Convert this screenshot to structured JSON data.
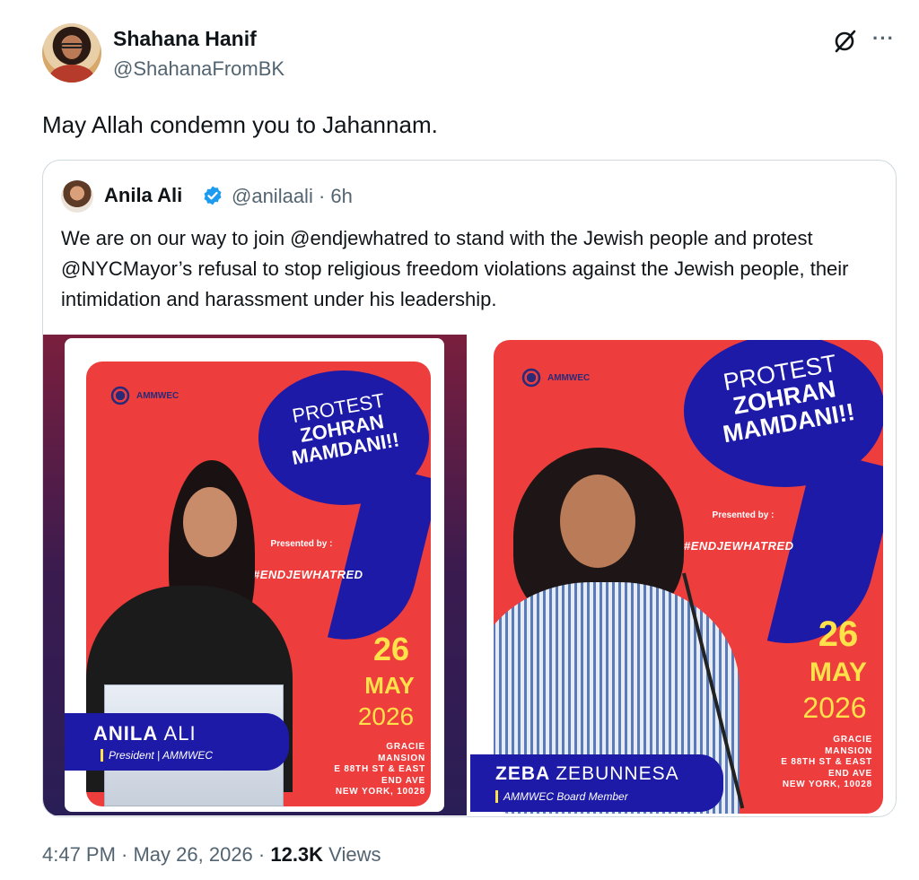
{
  "author": {
    "display_name": "Shahana Hanif",
    "handle": "@ShahanaFromBK"
  },
  "tweet": {
    "text": "May Allah condemn you to Jahannam."
  },
  "header_actions": {
    "grok_icon": "slashed-circle-icon",
    "more_icon": "more-icon",
    "more_label": "···"
  },
  "quoted": {
    "display_name": "Anila Ali",
    "verified_color": "#1d9bf0",
    "handle_time": "@anilaali · 6h",
    "text": "We are on our way to join @endjewhatred  to stand with the Jewish people and protest @NYCMayor’s refusal to stop religious freedom violations against the Jewish people, their intimidation and harassment under his leadership."
  },
  "flyers": [
    {
      "org": "AMMWEC",
      "headline_1": "PROTEST",
      "headline_2": "ZOHRAN",
      "headline_3": "MAMDANI!!",
      "presented_by": "Presented by :",
      "hashtag": "#ENDJEWHATRED",
      "day": "26",
      "month": "MAY",
      "year": "2026",
      "venue_1": "GRACIE",
      "venue_2": "MANSION",
      "venue_3": "E 88TH ST & EAST",
      "venue_4": "END AVE",
      "venue_5": "NEW YORK, 10028",
      "person_first": "ANILA",
      "person_last": "ALI",
      "person_role": "President | AMMWEC"
    },
    {
      "org": "AMMWEC",
      "headline_1": "PROTEST",
      "headline_2": "ZOHRAN",
      "headline_3": "MAMDANI!!",
      "presented_by": "Presented by :",
      "hashtag": "#ENDJEWHATRED",
      "day": "26",
      "month": "MAY",
      "year": "2026",
      "venue_1": "GRACIE",
      "venue_2": "MANSION",
      "venue_3": "E 88TH ST & EAST",
      "venue_4": "END AVE",
      "venue_5": "NEW YORK, 10028",
      "person_first": "ZEBA",
      "person_last": "ZEBUNNESA",
      "person_role": "AMMWEC Board Member"
    }
  ],
  "meta": {
    "time_date": "4:47 PM · May 26, 2026 · ",
    "views_count": "12.3K",
    "views_label": " Views"
  },
  "colors": {
    "flyer_red": "#ee3d3d",
    "flyer_blue": "#1c1aa6",
    "date_yellow": "#ffe14a",
    "secondary_text": "#536471"
  }
}
